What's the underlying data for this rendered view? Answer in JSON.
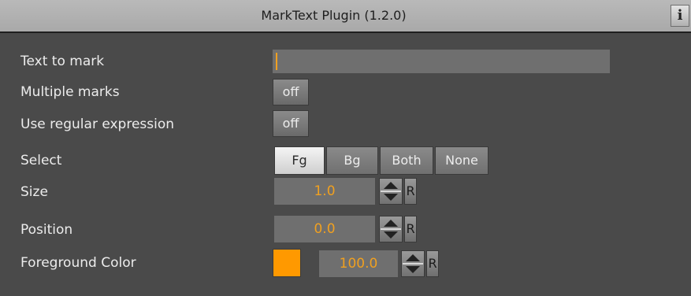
{
  "title": "MarkText Plugin (1.2.0)",
  "info_glyph": "i",
  "fields": {
    "text_to_mark": {
      "label": "Text to mark",
      "value": ""
    },
    "multiple_marks": {
      "label": "Multiple marks",
      "value": "off"
    },
    "use_regex": {
      "label": "Use regular expression",
      "value": "off"
    },
    "select": {
      "label": "Select",
      "options": [
        "Fg",
        "Bg",
        "Both",
        "None"
      ],
      "selected": "Fg"
    },
    "size": {
      "label": "Size",
      "value": "1.0",
      "reset": "R"
    },
    "position": {
      "label": "Position",
      "value": "0.0",
      "reset": "R"
    },
    "foreground_color": {
      "label": "Foreground Color",
      "color": "#ff9900",
      "value": "100.0",
      "reset": "R"
    }
  },
  "colors": {
    "panel_bg": "#4a4a4a",
    "title_bg": "#b0b0b0",
    "accent_value": "#f0a020",
    "field_bg": "#6f6f6f"
  },
  "icons": {
    "info": "info-icon",
    "spinner": "spinner-icon"
  }
}
